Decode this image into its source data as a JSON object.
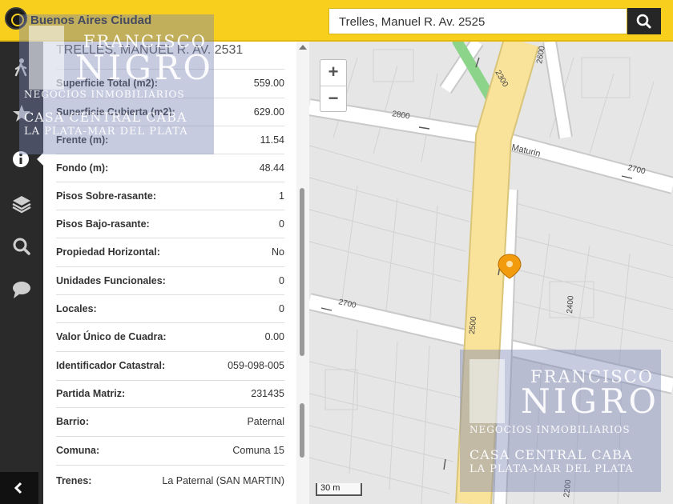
{
  "header": {
    "brand": "Buenos Aires Ciudad",
    "search_value": "Trelles, Manuel R. Av. 2525",
    "search_icon": "search-icon"
  },
  "sidebar": {
    "items": [
      {
        "icon": "walking-person-icon"
      },
      {
        "icon": "star-icon"
      },
      {
        "icon": "info-icon",
        "active": true
      },
      {
        "icon": "layers-icon"
      },
      {
        "icon": "search-icon"
      },
      {
        "icon": "comment-icon"
      }
    ],
    "collapse_icon": "chevron-left-icon"
  },
  "panel": {
    "title": "TRELLES, MANUEL R. AV. 2531",
    "rows": [
      {
        "label": "Superficie Total (m2):",
        "value": "559.00"
      },
      {
        "label": "Superficie Cubierta (m2):",
        "value": "629.00"
      },
      {
        "label": "Frente (m):",
        "value": "11.54"
      },
      {
        "label": "Fondo (m):",
        "value": "48.44"
      },
      {
        "label": "Pisos Sobre-rasante:",
        "value": "1"
      },
      {
        "label": "Pisos Bajo-rasante:",
        "value": "0"
      },
      {
        "label": "Propiedad Horizontal:",
        "value": "No"
      },
      {
        "label": "Unidades Funcionales:",
        "value": "0"
      },
      {
        "label": "Locales:",
        "value": "0"
      },
      {
        "label": "Valor Único de Cuadra:",
        "value": "0.00"
      },
      {
        "label": "Identificador Catastral:",
        "value": "059-098-005"
      },
      {
        "label": "Partida Matriz:",
        "value": "231435"
      },
      {
        "label": "Barrio:",
        "value": "Paternal"
      },
      {
        "label": "Comuna:",
        "value": "Comuna 15"
      },
      {
        "label": "Trenes:",
        "value": "La Paternal (SAN MARTIN)"
      }
    ]
  },
  "map": {
    "zoom_in": "+",
    "zoom_out": "−",
    "scale_label": "30 m",
    "street_labels": {
      "maturin": "Maturin",
      "n2800": "2800",
      "n2700_right": "2700",
      "n2700_left": "2700",
      "n2600": "2600",
      "n2300": "2300",
      "n2500": "2500",
      "n2400": "2400",
      "n2200": "2200"
    },
    "marker_icon": "location-pin-icon",
    "marker_color": "#f29b0c"
  },
  "watermark": {
    "line1": "FRANCISCO",
    "line2": "NIGRO",
    "line3": "NEGOCIOS INMOBILIARIOS",
    "line4": "CASA CENTRAL CABA",
    "line5": "LA PLATA-MAR DEL PLATA"
  },
  "colors": {
    "header": "#f7cf1c",
    "sidebar": "#2a2a2a",
    "avenue": "#f9e29a",
    "road": "#ffffff",
    "park": "#8cd48a"
  }
}
